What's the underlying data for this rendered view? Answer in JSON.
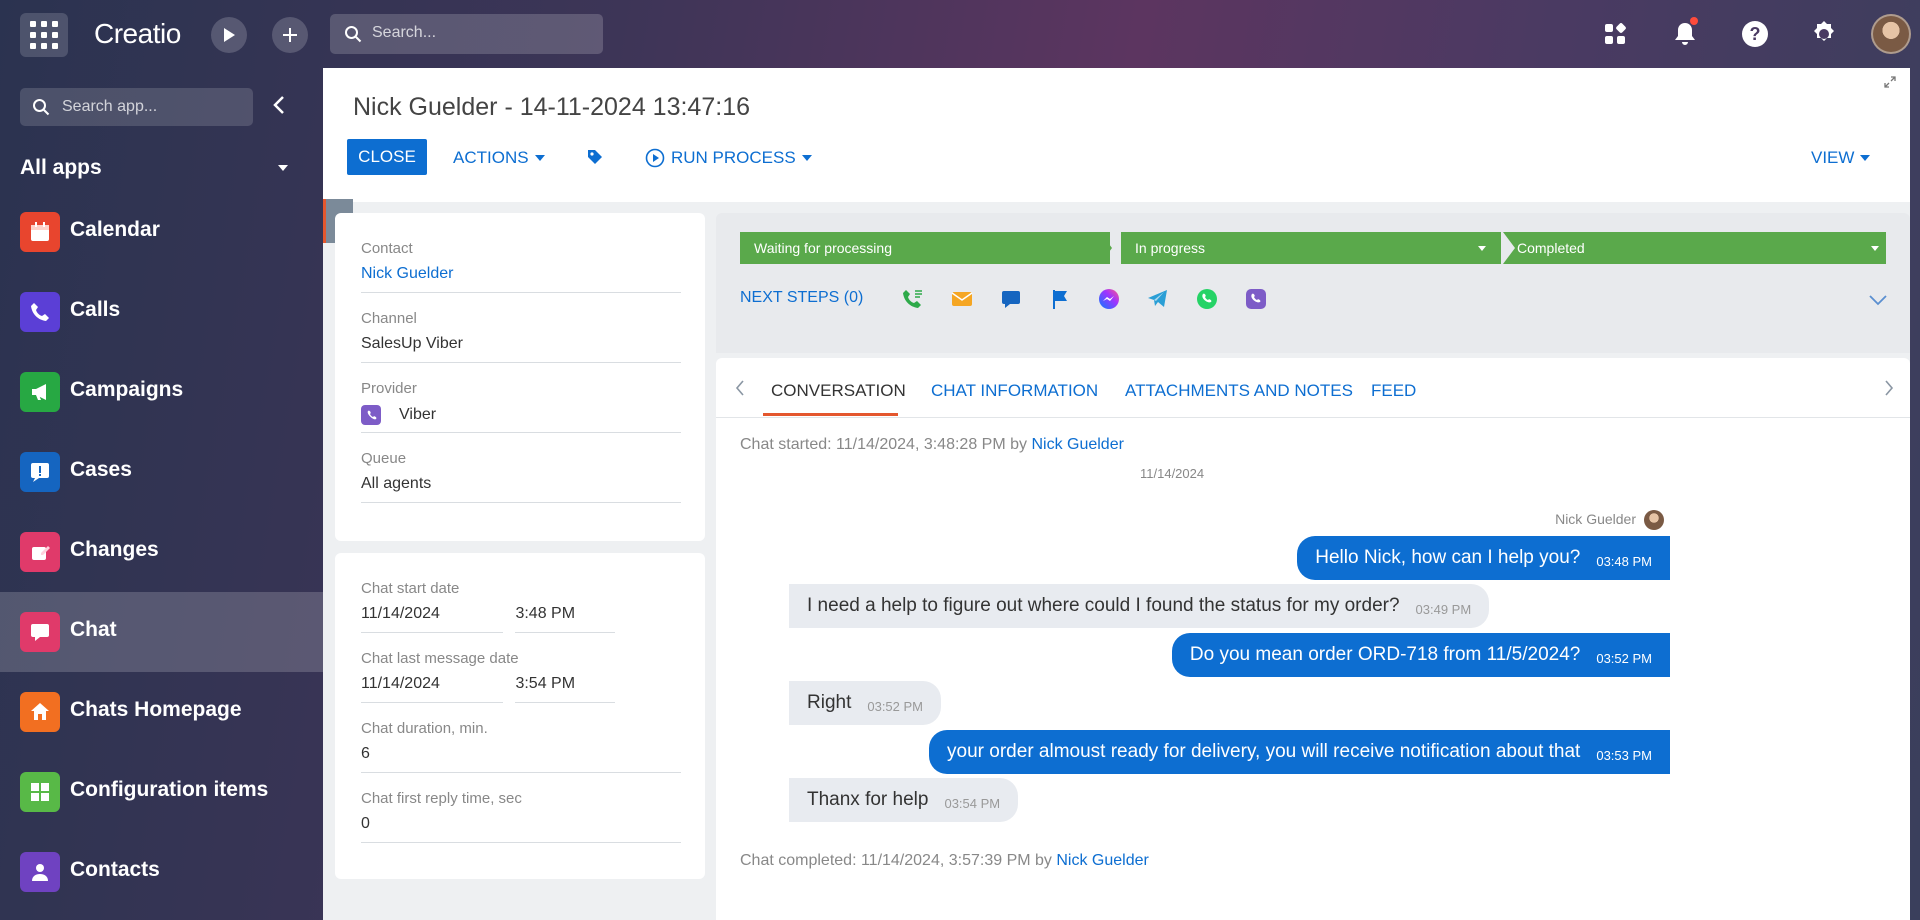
{
  "topbar": {
    "logo": "Creatio",
    "search_placeholder": "Search..."
  },
  "sidebar": {
    "search_placeholder": "Search app...",
    "section_title": "All apps",
    "items": [
      {
        "label": "Calendar",
        "icon": "calendar-icon",
        "color": "#e8452e"
      },
      {
        "label": "Calls",
        "icon": "phone-icon",
        "color": "#5b3fd6"
      },
      {
        "label": "Campaigns",
        "icon": "megaphone-icon",
        "color": "#27a843"
      },
      {
        "label": "Cases",
        "icon": "exclamation-icon",
        "color": "#1565c0"
      },
      {
        "label": "Changes",
        "icon": "edit-icon",
        "color": "#e03a6a"
      },
      {
        "label": "Chat",
        "icon": "chat-icon",
        "color": "#e03a6a"
      },
      {
        "label": "Chats Homepage",
        "icon": "home-icon",
        "color": "#f26f21"
      },
      {
        "label": "Configuration items",
        "icon": "layout-icon",
        "color": "#58b947"
      },
      {
        "label": "Contacts",
        "icon": "person-icon",
        "color": "#6f42c1"
      }
    ]
  },
  "record": {
    "title": "Nick Guelder - 14-11-2024 13:47:16",
    "close_label": "CLOSE",
    "actions_label": "ACTIONS",
    "run_process_label": "RUN PROCESS",
    "view_label": "VIEW"
  },
  "fields": {
    "contact_label": "Contact",
    "contact_value": "Nick Guelder",
    "channel_label": "Channel",
    "channel_value": "SalesUp Viber",
    "provider_label": "Provider",
    "provider_value": "Viber",
    "queue_label": "Queue",
    "queue_value": "All agents",
    "start_date_label": "Chat start date",
    "start_date": "11/14/2024",
    "start_time": "3:48 PM",
    "last_msg_label": "Chat last message date",
    "last_msg_date": "11/14/2024",
    "last_msg_time": "3:54 PM",
    "duration_label": "Chat duration, min.",
    "duration_value": "6",
    "first_reply_label": "Chat first reply time, sec",
    "first_reply_value": "0"
  },
  "stages": {
    "items": [
      "Waiting for processing",
      "In progress",
      "Completed"
    ],
    "color": "#5aa94b",
    "next_steps_label": "NEXT STEPS (0)"
  },
  "tabs": [
    "CONVERSATION",
    "CHAT INFORMATION",
    "ATTACHMENTS AND NOTES",
    "FEED"
  ],
  "conversation": {
    "started_prefix": "Chat started: 11/14/2024, 3:48:28 PM by",
    "started_by": "Nick Guelder",
    "date_separator": "11/14/2024",
    "sender_name": "Nick Guelder",
    "messages": [
      {
        "dir": "out",
        "text": "Hello Nick, how can I help you?",
        "time": "03:48 PM"
      },
      {
        "dir": "in",
        "text": "I need a help to figure out where could I found the status for my order?",
        "time": "03:49 PM"
      },
      {
        "dir": "out",
        "text": "Do you mean order ORD-718 from 11/5/2024?",
        "time": "03:52 PM"
      },
      {
        "dir": "in",
        "text": "Right",
        "time": "03:52 PM"
      },
      {
        "dir": "out",
        "text": "your order almoust ready for delivery, you will receive notification about that",
        "time": "03:53 PM"
      },
      {
        "dir": "in",
        "text": "Thanx for help",
        "time": "03:54 PM"
      }
    ],
    "completed_prefix": "Chat completed: 11/14/2024, 3:57:39 PM by",
    "completed_by": "Nick Guelder"
  },
  "colors": {
    "accent": "#0d6ed1",
    "tab_underline": "#e4572e"
  }
}
